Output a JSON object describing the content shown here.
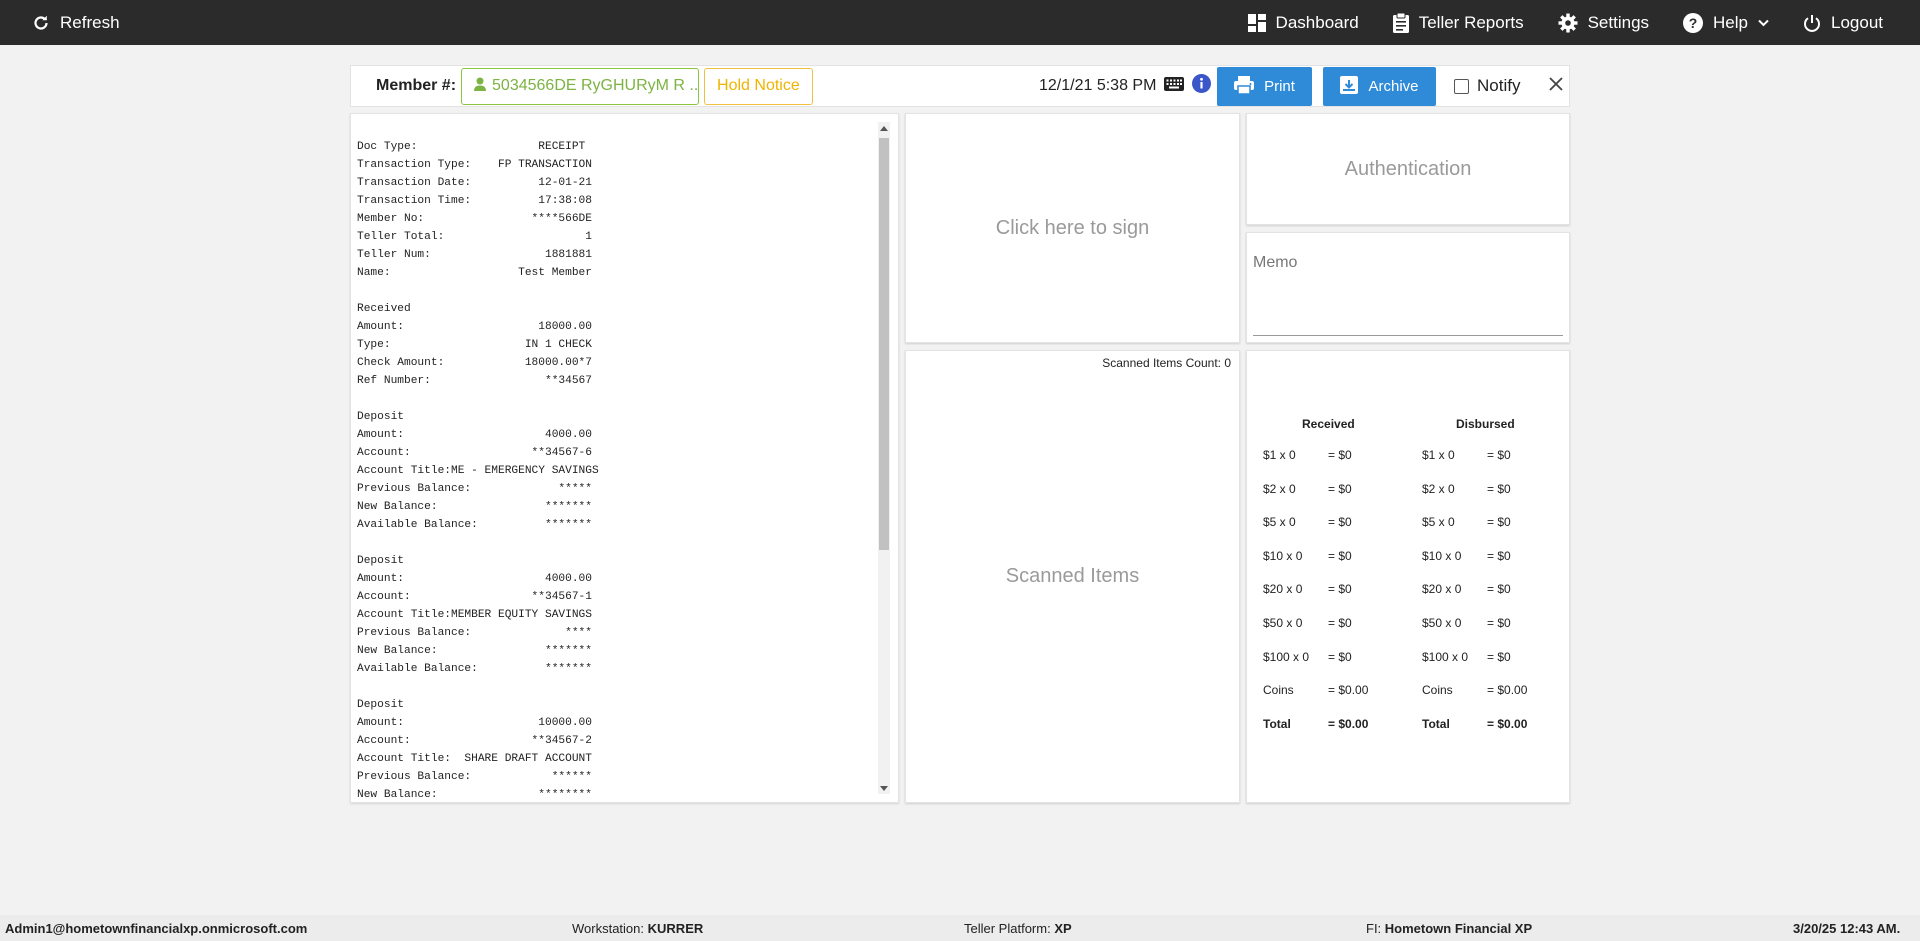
{
  "topbar": {
    "refresh_label": "Refresh",
    "dashboard_label": "Dashboard",
    "teller_reports_label": "Teller Reports",
    "settings_label": "Settings",
    "help_label": "Help",
    "logout_label": "Logout"
  },
  "header": {
    "member_label": "Member #:",
    "member_value": "5034566DE RyGHURyM R ...",
    "hold_notice_label": "Hold Notice",
    "datetime": "12/1/21 5:38 PM",
    "print_label": "Print",
    "archive_label": "Archive",
    "notify_label": "Notify",
    "colors": {
      "member_green": "#7cb342",
      "hold_yellow": "#f0b400",
      "button_blue": "#2f8ad8"
    }
  },
  "receipt": {
    "lines": [
      "Doc Type:                  RECEIPT",
      "Transaction Type:    FP TRANSACTION",
      "Transaction Date:          12-01-21",
      "Transaction Time:          17:38:08",
      "Member No:                ****566DE",
      "Teller Total:                     1",
      "Teller Num:                 1881881",
      "Name:                   Test Member",
      "",
      "Received",
      "Amount:                    18000.00",
      "Type:                    IN 1 CHECK",
      "Check Amount:            18000.00*7",
      "Ref Number:                 **34567",
      "",
      "Deposit",
      "Amount:                     4000.00",
      "Account:                  **34567-6",
      "Account Title:ME - EMERGENCY SAVINGS",
      "Previous Balance:             *****",
      "New Balance:                *******",
      "Available Balance:          *******",
      "",
      "Deposit",
      "Amount:                     4000.00",
      "Account:                  **34567-1",
      "Account Title:MEMBER EQUITY SAVINGS",
      "Previous Balance:              ****",
      "New Balance:                *******",
      "Available Balance:          *******",
      "",
      "Deposit",
      "Amount:                    10000.00",
      "Account:                  **34567-2",
      "Account Title:  SHARE DRAFT ACCOUNT",
      "Previous Balance:            ******",
      "New Balance:               ********"
    ]
  },
  "sign": {
    "label": "Click here to sign"
  },
  "scanned": {
    "count_label": "Scanned Items Count: 0",
    "title": "Scanned Items"
  },
  "auth": {
    "label": "Authentication"
  },
  "memo": {
    "label": "Memo"
  },
  "cash": {
    "received_header": "Received",
    "disbursed_header": "Disbursed",
    "received": [
      {
        "denom": "$1 x 0",
        "value": "= $0"
      },
      {
        "denom": "$2 x 0",
        "value": "= $0"
      },
      {
        "denom": "$5 x 0",
        "value": "= $0"
      },
      {
        "denom": "$10 x 0",
        "value": "= $0"
      },
      {
        "denom": "$20 x 0",
        "value": "= $0"
      },
      {
        "denom": "$50 x 0",
        "value": "= $0"
      },
      {
        "denom": "$100 x 0",
        "value": "= $0"
      },
      {
        "denom": "Coins",
        "value": "= $0.00"
      },
      {
        "denom": "Total",
        "value": "= $0.00"
      }
    ],
    "disbursed": [
      {
        "denom": "$1 x 0",
        "value": "= $0"
      },
      {
        "denom": "$2 x 0",
        "value": "= $0"
      },
      {
        "denom": "$5 x 0",
        "value": "= $0"
      },
      {
        "denom": "$10 x 0",
        "value": "= $0"
      },
      {
        "denom": "$20 x 0",
        "value": "= $0"
      },
      {
        "denom": "$50 x 0",
        "value": "= $0"
      },
      {
        "denom": "$100 x 0",
        "value": "= $0"
      },
      {
        "denom": "Coins",
        "value": "= $0.00"
      },
      {
        "denom": "Total",
        "value": "= $0.00"
      }
    ]
  },
  "footer": {
    "user": "Admin1@hometownfinancialxp.onmicrosoft.com",
    "workstation_label": "Workstation:",
    "workstation_value": "KURRER",
    "platform_label": "Teller Platform:",
    "platform_value": "XP",
    "fi_label": "FI:",
    "fi_value": "Hometown Financial XP",
    "datetime": "3/20/25 12:43 AM."
  }
}
